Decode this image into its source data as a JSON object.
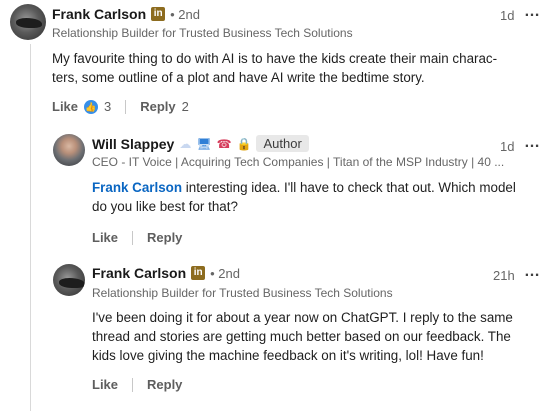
{
  "comments": [
    {
      "name": "Frank Carlson",
      "badge": "in",
      "degree": "• 2nd",
      "headline": "Relationship Builder for Trusted Business Tech Solutions",
      "time": "1d",
      "text": "My favourite thing to do with AI is to have the kids create their main charac-ters, some outline of a plot and have AI write the bedtime story.",
      "text_line1": "My favourite thing to do with AI is to have the kids create their main charac-",
      "text_line2": "ters, some outline of a plot and have AI write the bedtime story.",
      "like_label": "Like",
      "like_count": "3",
      "reply_label": "Reply",
      "reply_count": "2",
      "reaction_icon": "thumbs-up-icon"
    }
  ],
  "replies": [
    {
      "name": "Will Slappey",
      "emojis": [
        "☁",
        "🖥",
        "☎",
        "🔒"
      ],
      "author_badge": "Author",
      "headline": "CEO - IT Voice | Acquiring Tech Companies | Titan of the MSP Industry | 40 ...",
      "time": "1d",
      "mention": "Frank Carlson",
      "text_after_mention": " interesting idea.  I'll have to check that out.  Which model",
      "text_line2": "do you like best for that?",
      "like_label": "Like",
      "reply_label": "Reply"
    },
    {
      "name": "Frank Carlson",
      "badge": "in",
      "degree": "• 2nd",
      "headline": "Relationship Builder for Trusted Business Tech Solutions",
      "time": "21h",
      "text_line1": "I've been doing it for about a year now on ChatGPT.  I reply to the same",
      "text_line2": "thread and stories are getting much better based on our feedback.  The",
      "text_line3": "kids love giving the machine feedback on it's writing, lol! Have fun!",
      "like_label": "Like",
      "reply_label": "Reply"
    }
  ],
  "more_icon": "…",
  "colors": {
    "link": "#0a66c2",
    "like_icon": "#378fe9",
    "badge": "#8d6c1f"
  }
}
